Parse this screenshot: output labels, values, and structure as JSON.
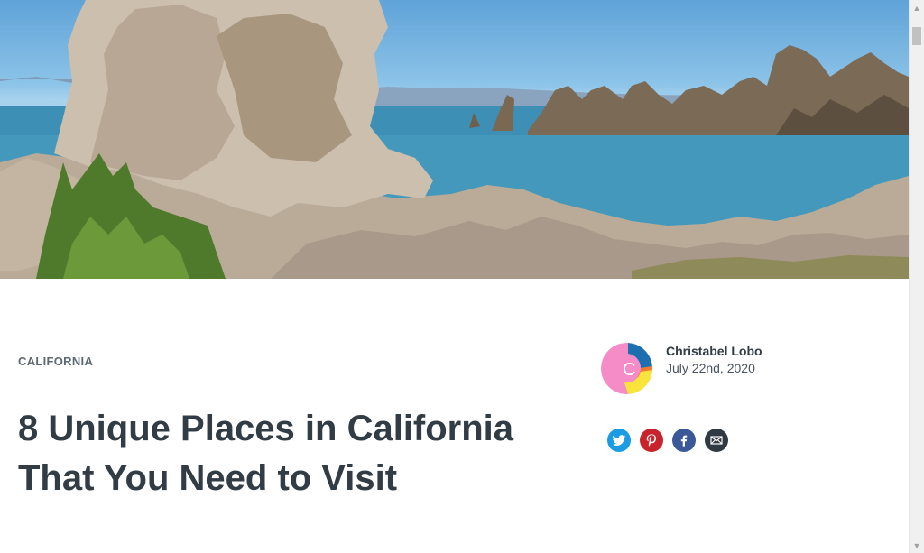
{
  "article": {
    "category": "CALIFORNIA",
    "title": "8 Unique Places in California That You Need to Visit"
  },
  "author": {
    "name": "Christabel Lobo",
    "date": "July 22nd, 2020",
    "avatar_initial": "C"
  },
  "share": [
    {
      "name": "twitter",
      "icon": "twitter-icon",
      "color": "#1a9ce4"
    },
    {
      "name": "pinterest",
      "icon": "pinterest-icon",
      "color": "#c8232c"
    },
    {
      "name": "facebook",
      "icon": "facebook-icon",
      "color": "#3b5998"
    },
    {
      "name": "email",
      "icon": "email-icon",
      "color": "#2f3a42"
    }
  ],
  "colors": {
    "text_dark": "#313c45",
    "category": "#5f6a75"
  }
}
